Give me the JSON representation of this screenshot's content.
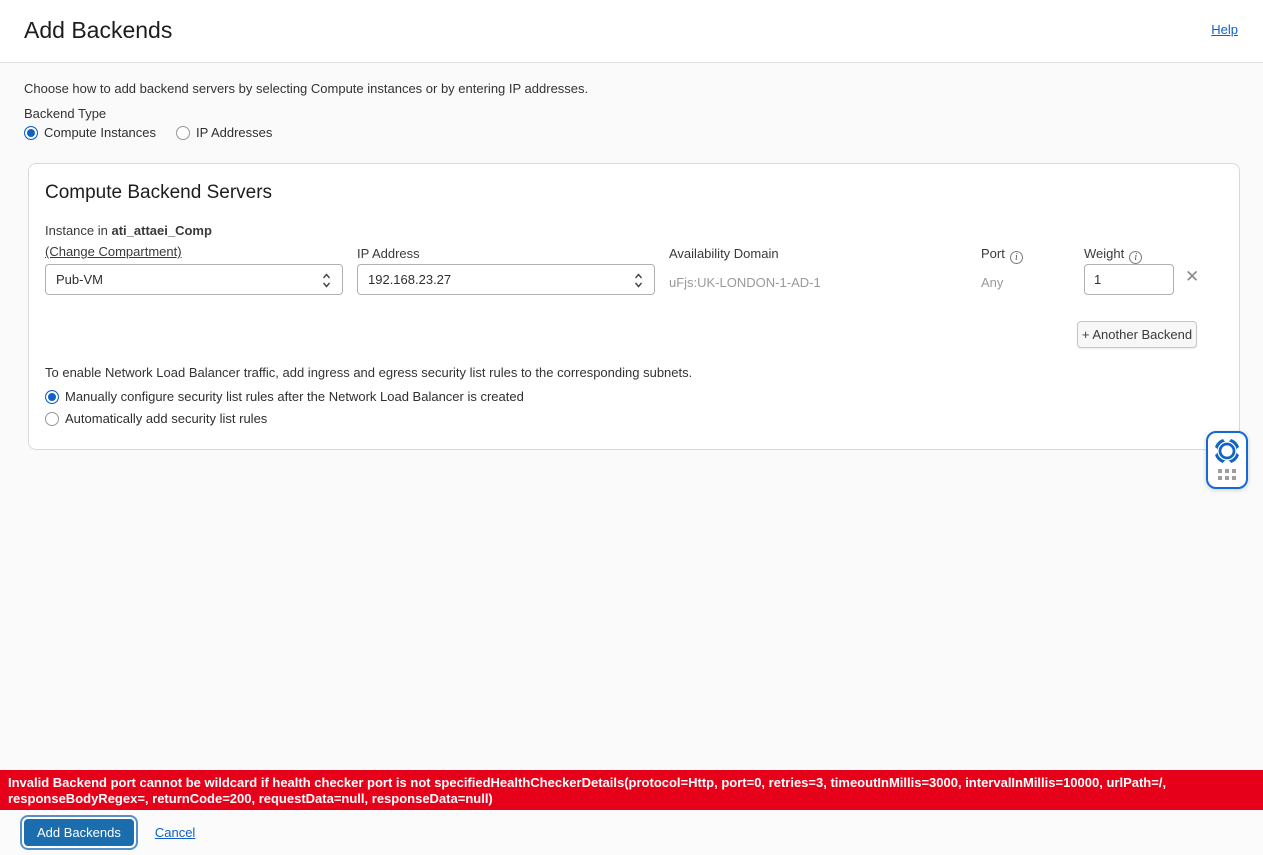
{
  "header": {
    "title": "Add Backends",
    "help_label": "Help"
  },
  "intro": {
    "description": "Choose how to add backend servers by selecting Compute instances or by entering IP addresses.",
    "backend_type_label": "Backend Type",
    "backend_type_options": [
      {
        "label": "Compute Instances",
        "selected": true
      },
      {
        "label": "IP Addresses",
        "selected": false
      }
    ]
  },
  "card": {
    "title": "Compute Backend Servers",
    "row": {
      "instance_label_prefix": "Instance in ",
      "compartment_name": "ati_attaei_Comp",
      "change_compartment_label": "(Change Compartment)",
      "instance_value": "Pub-VM",
      "ip_label": "IP Address",
      "ip_value": "192.168.23.27",
      "ad_label": "Availability Domain",
      "ad_value": "uFjs:UK-LONDON-1-AD-1",
      "port_label": "Port",
      "port_value": "Any",
      "weight_label": "Weight",
      "weight_value": "1"
    },
    "another_backend_label": "+ Another Backend",
    "security_note": "To enable Network Load Balancer traffic, add ingress and egress security list rules to the corresponding subnets.",
    "security_options": [
      {
        "label": "Manually configure security list rules after the Network Load Balancer is created",
        "selected": true
      },
      {
        "label": "Automatically add security list rules",
        "selected": false
      }
    ]
  },
  "error_banner": {
    "message": "Invalid Backend port cannot be wildcard if health checker port is not specifiedHealthCheckerDetails(protocol=Http, port=0, retries=3, timeoutInMillis=3000, intervalInMillis=10000, urlPath=/, responseBodyRegex=, returnCode=200, requestData=null, responseData=null)"
  },
  "footer": {
    "submit_label": "Add Backends",
    "cancel_label": "Cancel"
  },
  "icons": {
    "info_glyph": "i",
    "remove_glyph": "✕"
  },
  "colors": {
    "link": "#1060c8",
    "primary_button": "#1c6dad",
    "error": "#e60019",
    "radio_selected": "#1060c8"
  }
}
